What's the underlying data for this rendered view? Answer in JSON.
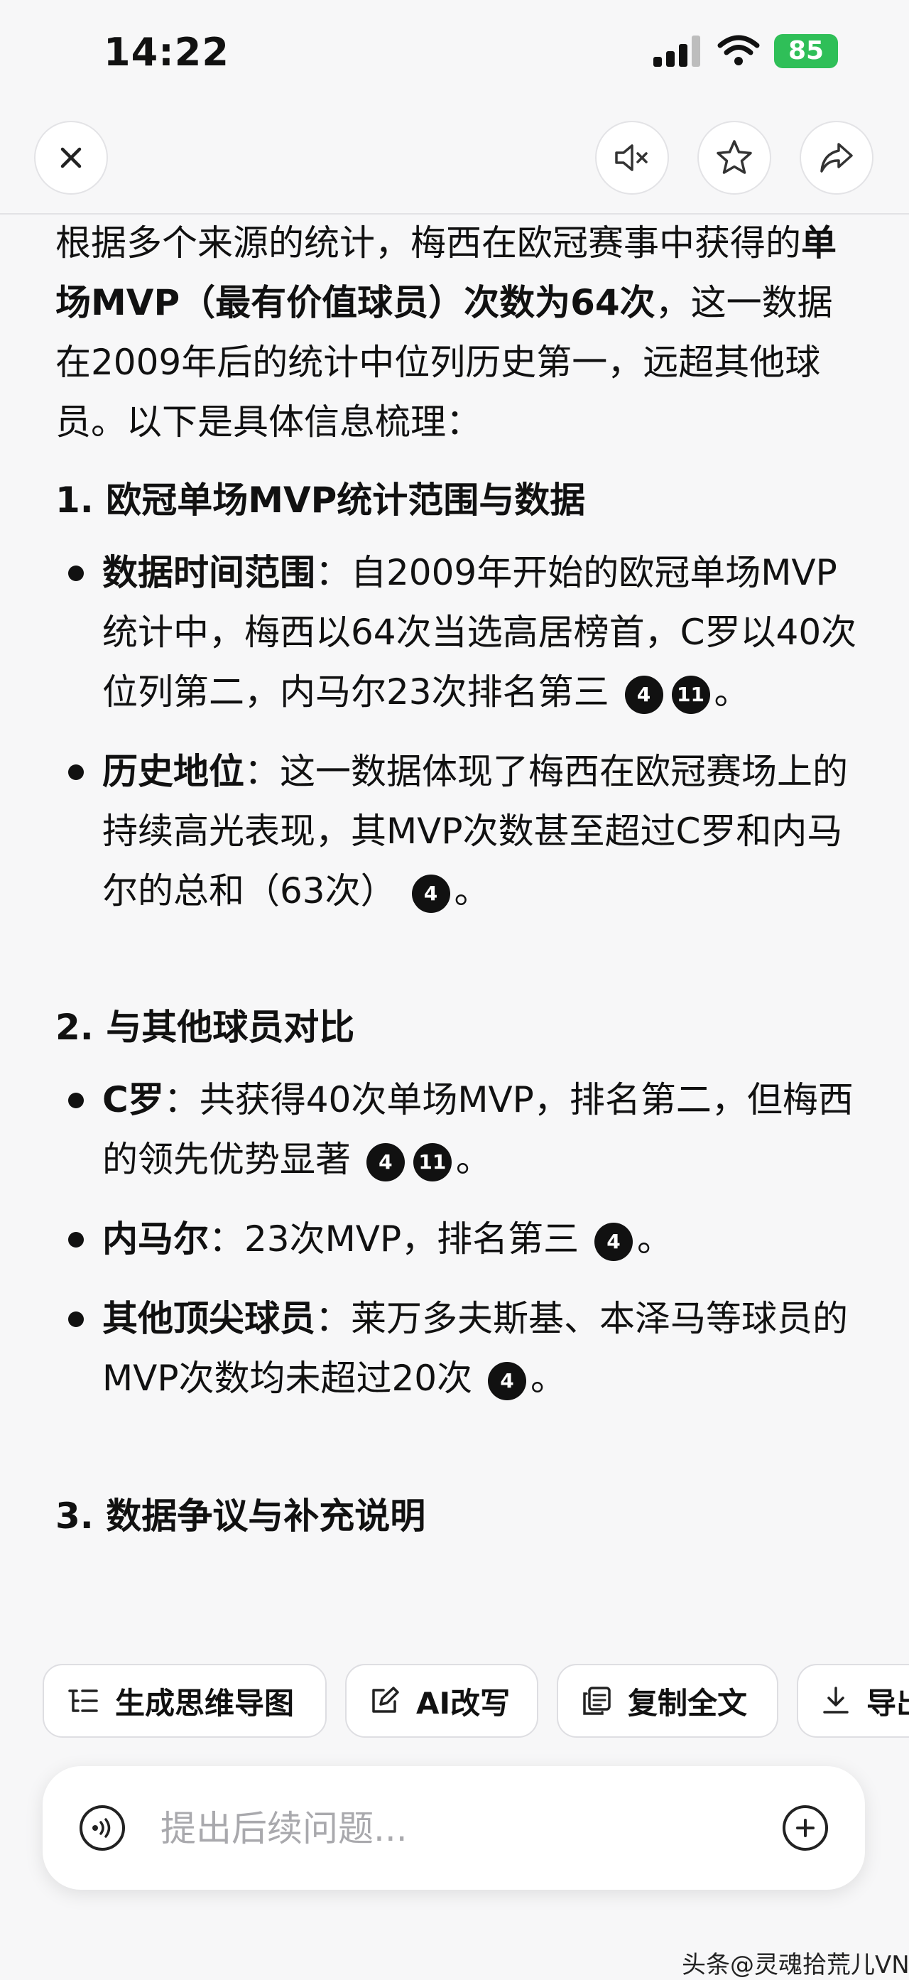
{
  "status_bar": {
    "time": "14:22",
    "battery": "85"
  },
  "article": {
    "intro": {
      "part1": "根据多个来源的统计，梅西在欧冠赛事中获得的",
      "bold": "单场MVP（最有价值球员）次数为64次",
      "part2": "，这一数据在2009年后的统计中位列历史第一，远超其他球员。以下是具体信息梳理："
    },
    "section1": {
      "heading": "1. 欧冠单场MVP统计范围与数据",
      "items": [
        {
          "label": "数据时间范围",
          "text": "：自2009年开始的欧冠单场MVP统计中，梅西以64次当选高居榜首，C罗以40次位列第二，内马尔23次排名第三",
          "cites": [
            "4",
            "11"
          ],
          "end": "。"
        },
        {
          "label": "历史地位",
          "text": "：这一数据体现了梅西在欧冠赛场上的持续高光表现，其MVP次数甚至超过C罗和内马尔的总和（63次）",
          "cites": [
            "4"
          ],
          "end": "。"
        }
      ]
    },
    "section2": {
      "heading": "2. 与其他球员对比",
      "items": [
        {
          "label": "C罗",
          "text": "：共获得40次单场MVP，排名第二，但梅西的领先优势显著",
          "cites": [
            "4",
            "11"
          ],
          "end": "。"
        },
        {
          "label": "内马尔",
          "text": "：23次MVP，排名第三",
          "cites": [
            "4"
          ],
          "end": "。"
        },
        {
          "label": "其他顶尖球员",
          "text": "：莱万多夫斯基、本泽马等球员的MVP次数均未超过20次",
          "cites": [
            "4"
          ],
          "end": "。"
        }
      ]
    },
    "section3": {
      "heading": "3. 数据争议与补充说明"
    }
  },
  "actions": {
    "mindmap": "生成思维导图",
    "rewrite": "AI改写",
    "copy": "复制全文",
    "export": "导出"
  },
  "input": {
    "placeholder": "提出后续问题..."
  },
  "watermark": "头条@灵魂拾荒儿VN"
}
